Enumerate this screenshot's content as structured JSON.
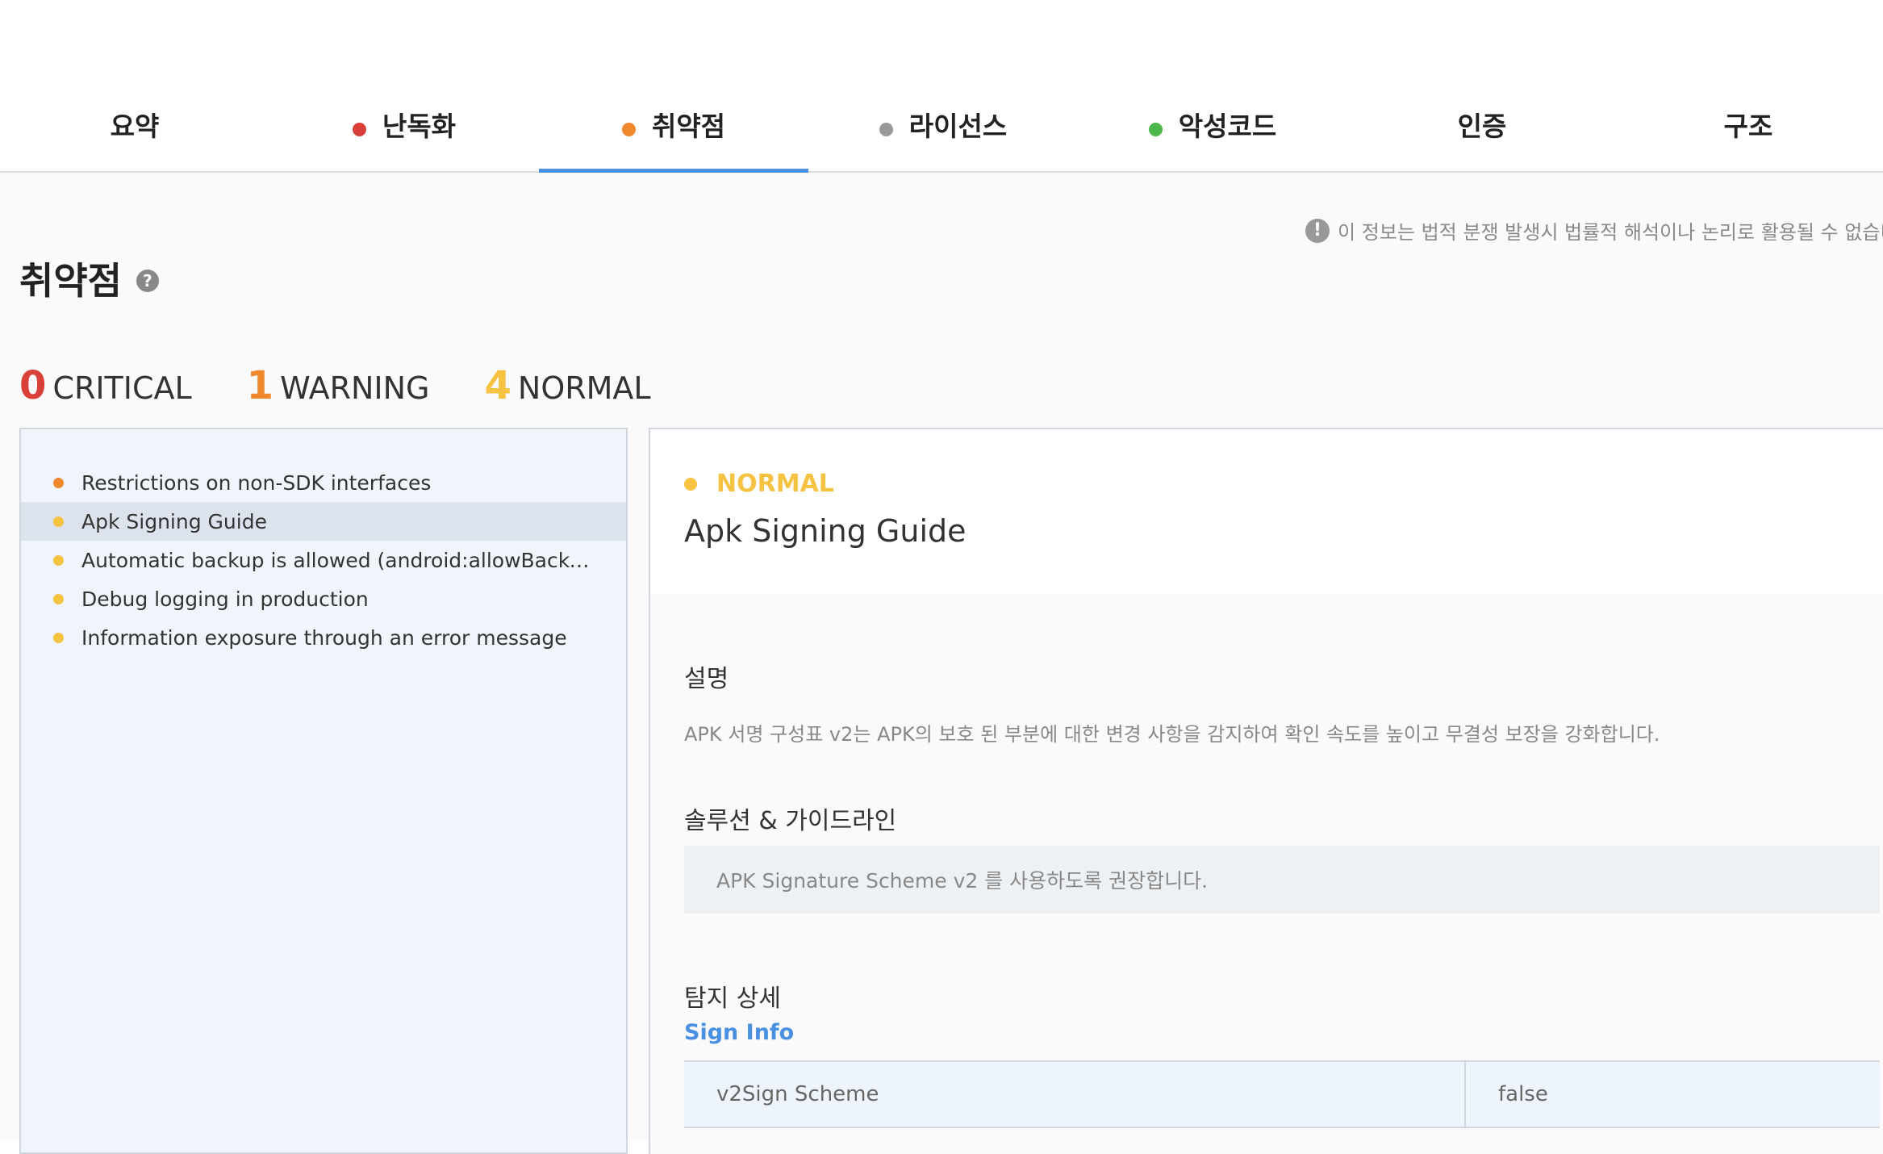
{
  "tabs": [
    {
      "label": "요약",
      "dot": null
    },
    {
      "label": "난독화",
      "dot": "#d9403a"
    },
    {
      "label": "취약점",
      "dot": "#f0882e"
    },
    {
      "label": "라이선스",
      "dot": "#999999"
    },
    {
      "label": "악성코드",
      "dot": "#4cb84c"
    },
    {
      "label": "인증",
      "dot": null
    },
    {
      "label": "구조",
      "dot": null
    }
  ],
  "active_tab": "취약점",
  "notice": "이 정보는 법적 분쟁 발생시 법률적 해석이나 논리로 활용될 수 없습니",
  "page": {
    "title": "취약점",
    "help_glyph": "?",
    "notice_glyph": "!"
  },
  "counts": {
    "critical": {
      "num": "0",
      "label": "CRITICAL",
      "color": "#d9403a"
    },
    "warning": {
      "num": "1",
      "label": "WARNING",
      "color": "#f0882e"
    },
    "normal": {
      "num": "4",
      "label": "NORMAL",
      "color": "#f5c242"
    }
  },
  "list": {
    "items": [
      {
        "label": "Restrictions on non-SDK interfaces",
        "color": "#f0882e"
      },
      {
        "label": "Apk Signing Guide",
        "color": "#f5c242"
      },
      {
        "label": "Automatic backup is allowed (android:allowBackup=tr...",
        "color": "#f5c242"
      },
      {
        "label": "Debug logging in production",
        "color": "#f5c242"
      },
      {
        "label": "Information exposure through an error message",
        "color": "#f5c242"
      }
    ],
    "selected_index": 1
  },
  "detail": {
    "severity": "NORMAL",
    "title": "Apk Signing Guide",
    "description_title": "설명",
    "description": "APK 서명 구성표 v2는 APK의 보호 된 부분에 대한 변경 사항을 감지하여 확인 속도를 높이고 무결성 보장을 강화합니다.",
    "solution_title": "솔루션 & 가이드라인",
    "solution": "APK Signature Scheme v2 를 사용하도록 권장합니다.",
    "detection_title": "탐지 상세",
    "sign_info_label": "Sign Info",
    "table": [
      {
        "key": "v2Sign Scheme",
        "value": "false"
      }
    ]
  },
  "colors": {
    "accent": "#4a90e2",
    "critical": "#d9403a",
    "warning": "#f0882e",
    "normal": "#f5c242"
  }
}
